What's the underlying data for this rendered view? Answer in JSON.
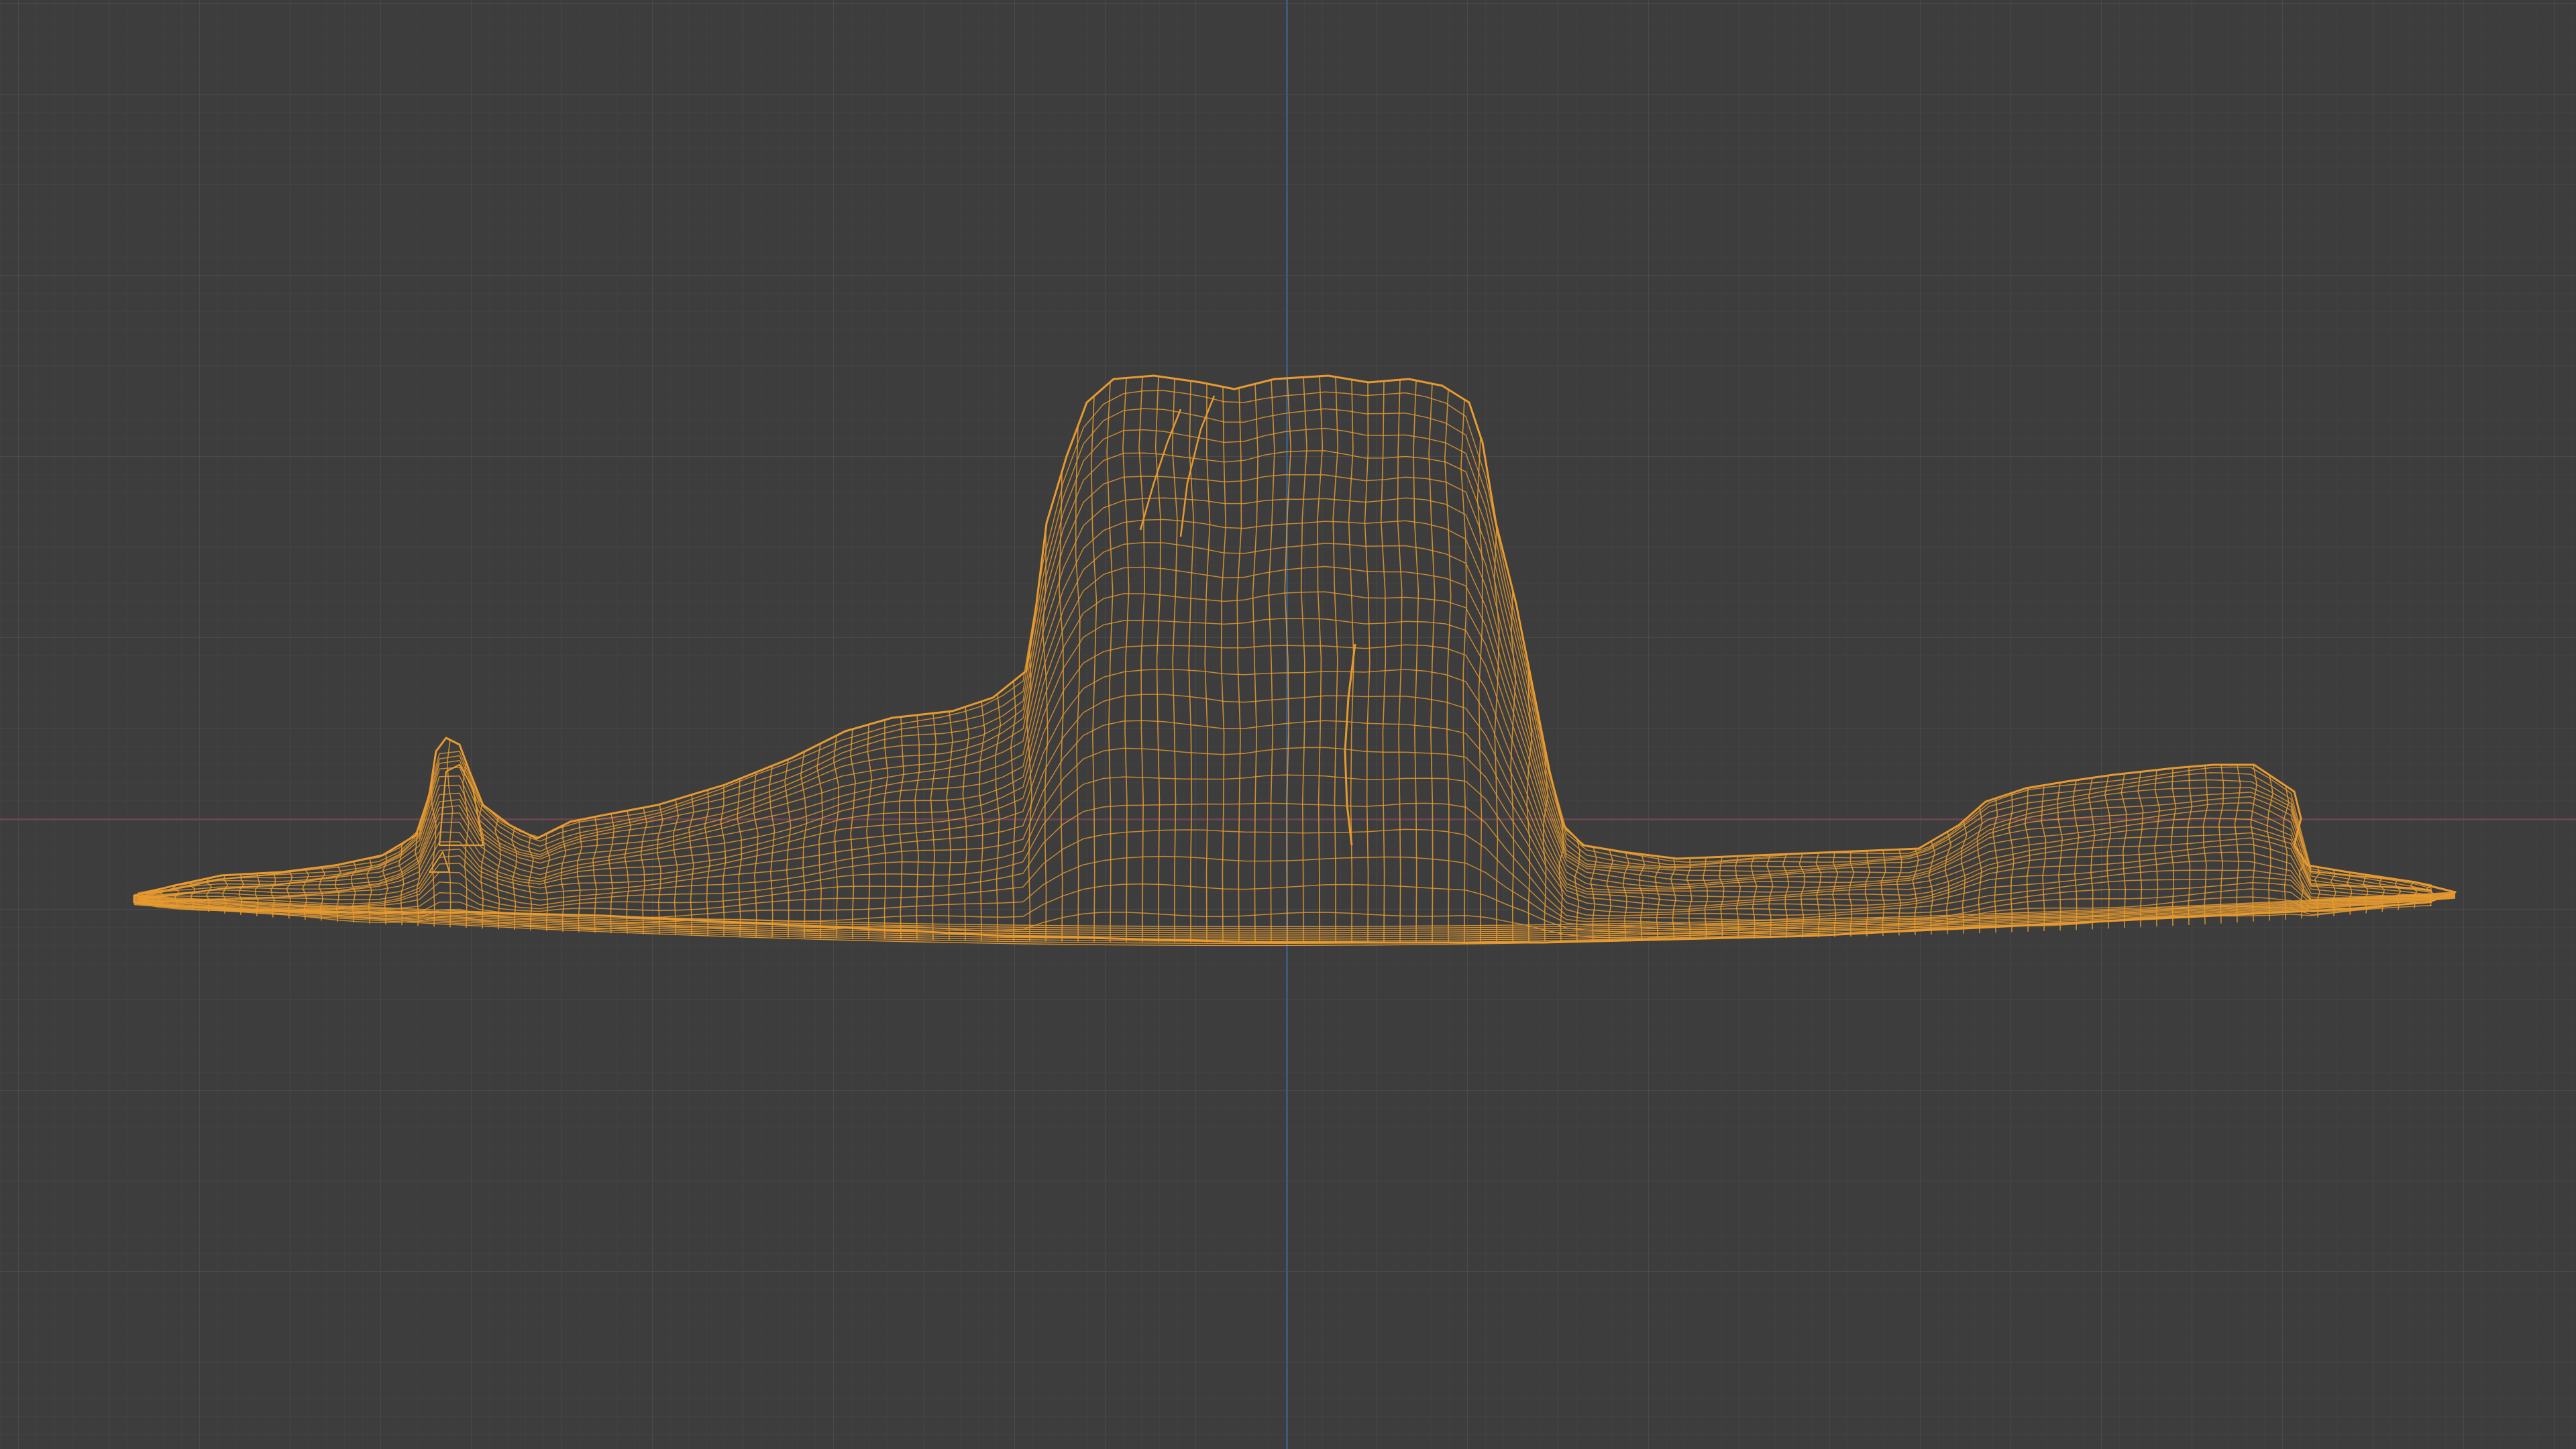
{
  "viewport": {
    "view": "wireframe",
    "background_color": "#3d3d3d",
    "grid_color": "#505050",
    "axis_x_color": "#6b4550",
    "axis_z_color": "#3e5878"
  },
  "mesh_object": {
    "description_icon": "mesa-terrain-mesh",
    "wire_color": "#f0a030"
  }
}
